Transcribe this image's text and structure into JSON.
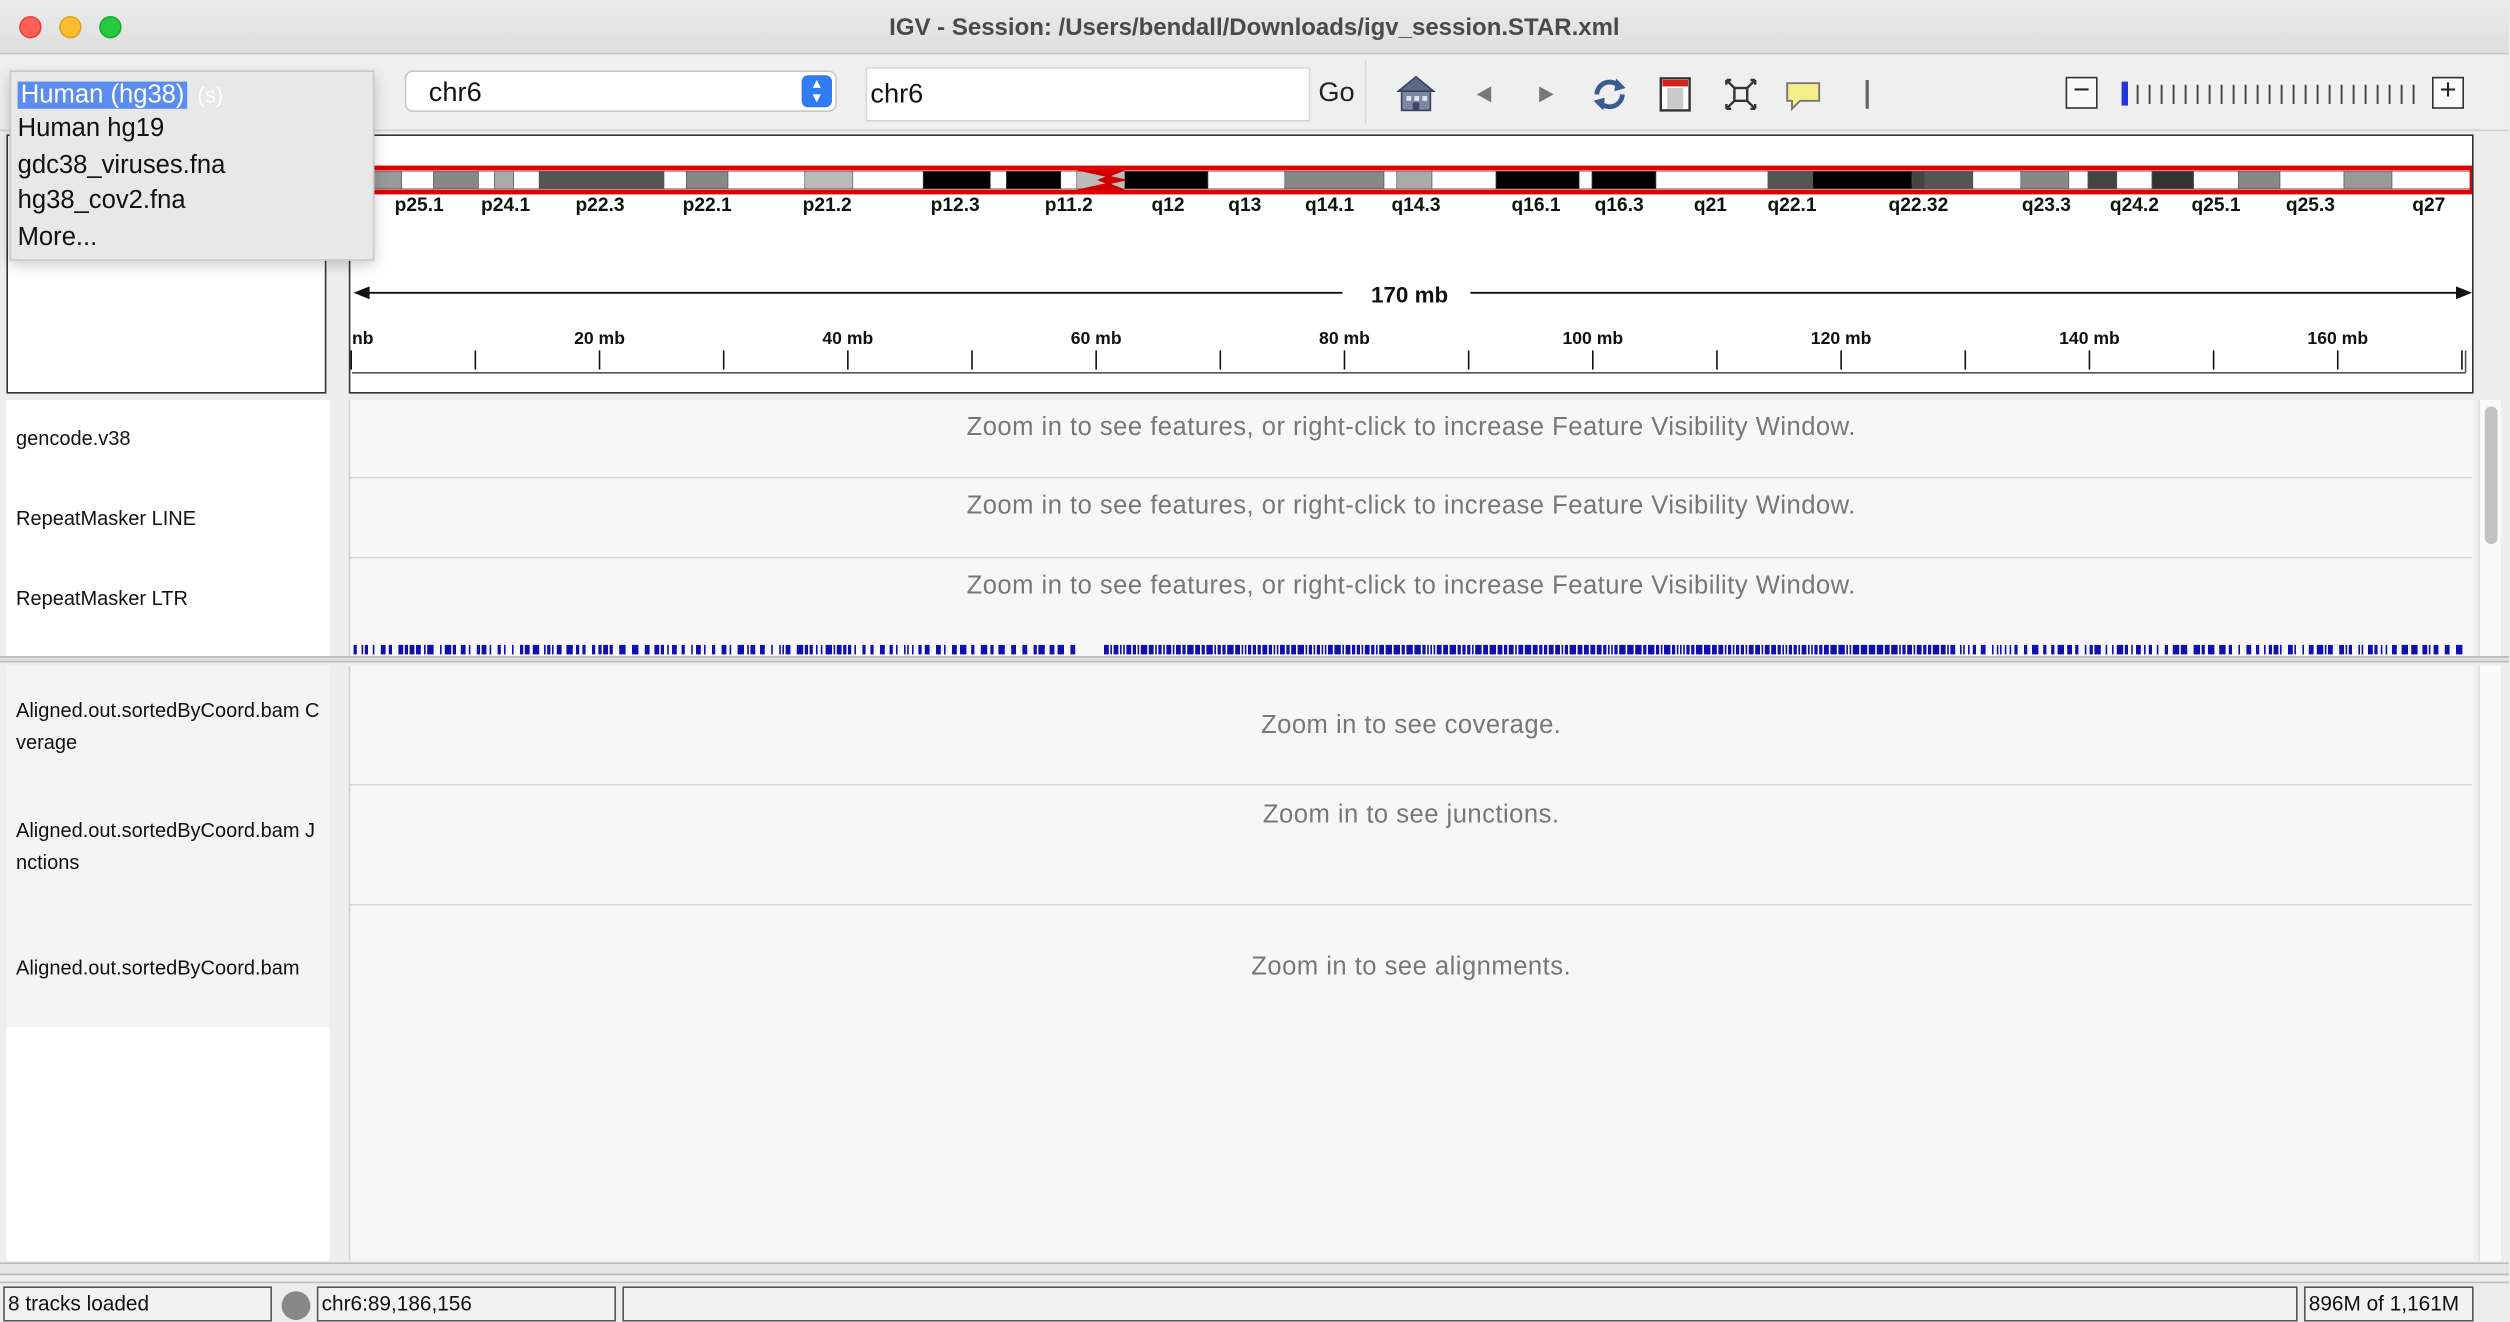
{
  "window": {
    "title": "IGV - Session: /Users/bendall/Downloads/igv_session.STAR.xml"
  },
  "toolbar": {
    "genome_selected": "Human (hg38)",
    "chromosome": "chr6",
    "locus_value": "chr6",
    "go_label": "Go",
    "icons": [
      "home-icon",
      "back-arrow-icon",
      "forward-arrow-icon",
      "refresh-icon",
      "region-of-interest-icon",
      "fit-to-window-icon",
      "popup-info-icon",
      "zoom-out-icon",
      "zoom-in-icon"
    ]
  },
  "genome_dropdown": {
    "options": [
      "Human (hg38)",
      "Human hg19",
      "gdc38_viruses.fna",
      "hg38_cov2.fna",
      "More..."
    ],
    "selected_index": 0,
    "ghost_suffix": "(s)"
  },
  "ideogram": {
    "band_labels": [
      "p25.1",
      "p24.1",
      "p22.3",
      "p22.1",
      "p21.2",
      "p12.3",
      "p11.2",
      "q12",
      "q13",
      "q14.1",
      "q14.3",
      "q16.1",
      "q16.3",
      "q21",
      "q22.1",
      "q22.32",
      "q23.3",
      "q24.2",
      "q25.1",
      "q25.3",
      "q27"
    ],
    "highlight_color": "#e00000"
  },
  "ruler": {
    "span_label": "170 mb",
    "first_tick_fragment": "nb",
    "tick_labels": [
      "20 mb",
      "40 mb",
      "60 mb",
      "80 mb",
      "100 mb",
      "120 mb",
      "140 mb",
      "160 mb"
    ]
  },
  "feature_panel": {
    "tracks": [
      {
        "name": "gencode.v38",
        "message": "Zoom in to see features, or right-click to increase Feature Visibility Window."
      },
      {
        "name": "RepeatMasker LINE",
        "message": "Zoom in to see features, or right-click to increase Feature Visibility Window."
      },
      {
        "name": "RepeatMasker LTR",
        "message": "Zoom in to see features, or right-click to increase Feature Visibility Window."
      }
    ],
    "gene_density_color": "#1010b0"
  },
  "alignment_panel": {
    "tracks": [
      {
        "name_line1": "Aligned.out.sortedByCoord.bam C",
        "name_line2": "verage",
        "message": "Zoom in to see coverage."
      },
      {
        "name_line1": "Aligned.out.sortedByCoord.bam J",
        "name_line2": "nctions",
        "message": "Zoom in to see junctions."
      },
      {
        "name_line1": "Aligned.out.sortedByCoord.bam",
        "name_line2": "",
        "message": "Zoom in to see alignments."
      }
    ]
  },
  "status": {
    "tracks_loaded": "8 tracks loaded",
    "position": "chr6:89,186,156",
    "memory": "896M of 1,161M"
  }
}
